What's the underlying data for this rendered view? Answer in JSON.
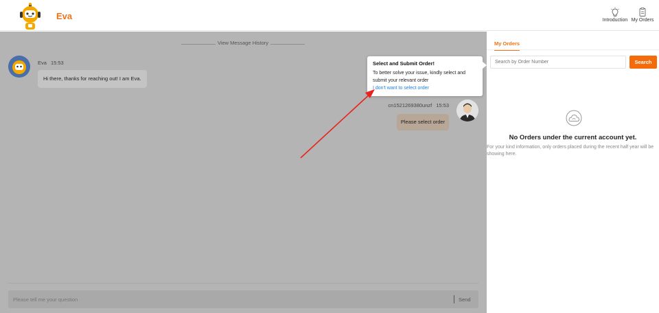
{
  "header": {
    "brand": "Eva",
    "intro_label": "Introduction",
    "orders_label": "My Orders"
  },
  "chat": {
    "history_label": "View Message History",
    "bot": {
      "name": "Eva",
      "time": "15:53",
      "message": "Hi there, thanks for reaching out! I am Eva."
    },
    "user": {
      "name": "cn1521269380unzf",
      "time": "15:53",
      "message": "Please select order"
    },
    "input_placeholder": "Please tell me your question",
    "send_label": "Send"
  },
  "tooltip": {
    "title": "Select and Submit Order!",
    "body": "To better solve your issue, kindly select and submit your relevant order",
    "link": "I don't want to select order"
  },
  "panel": {
    "tab": "My Orders",
    "search_placeholder": "Search by Order Number",
    "search_button": "Search",
    "empty_title": "No Orders under the current account yet.",
    "empty_note": "For your kind information, only orders placed during the recent half year will be showing here."
  },
  "colors": {
    "accent": "#f07316",
    "search_button": "#f36b0a",
    "overlay": "#b4b4b4",
    "link": "#1e7fe0",
    "annotation_arrow": "#e8231c"
  },
  "icons": {
    "logo": "robot-mascot-icon",
    "introduction": "lightbulb-icon",
    "my_orders": "clipboard-icon",
    "empty": "cloud-sad-icon"
  }
}
